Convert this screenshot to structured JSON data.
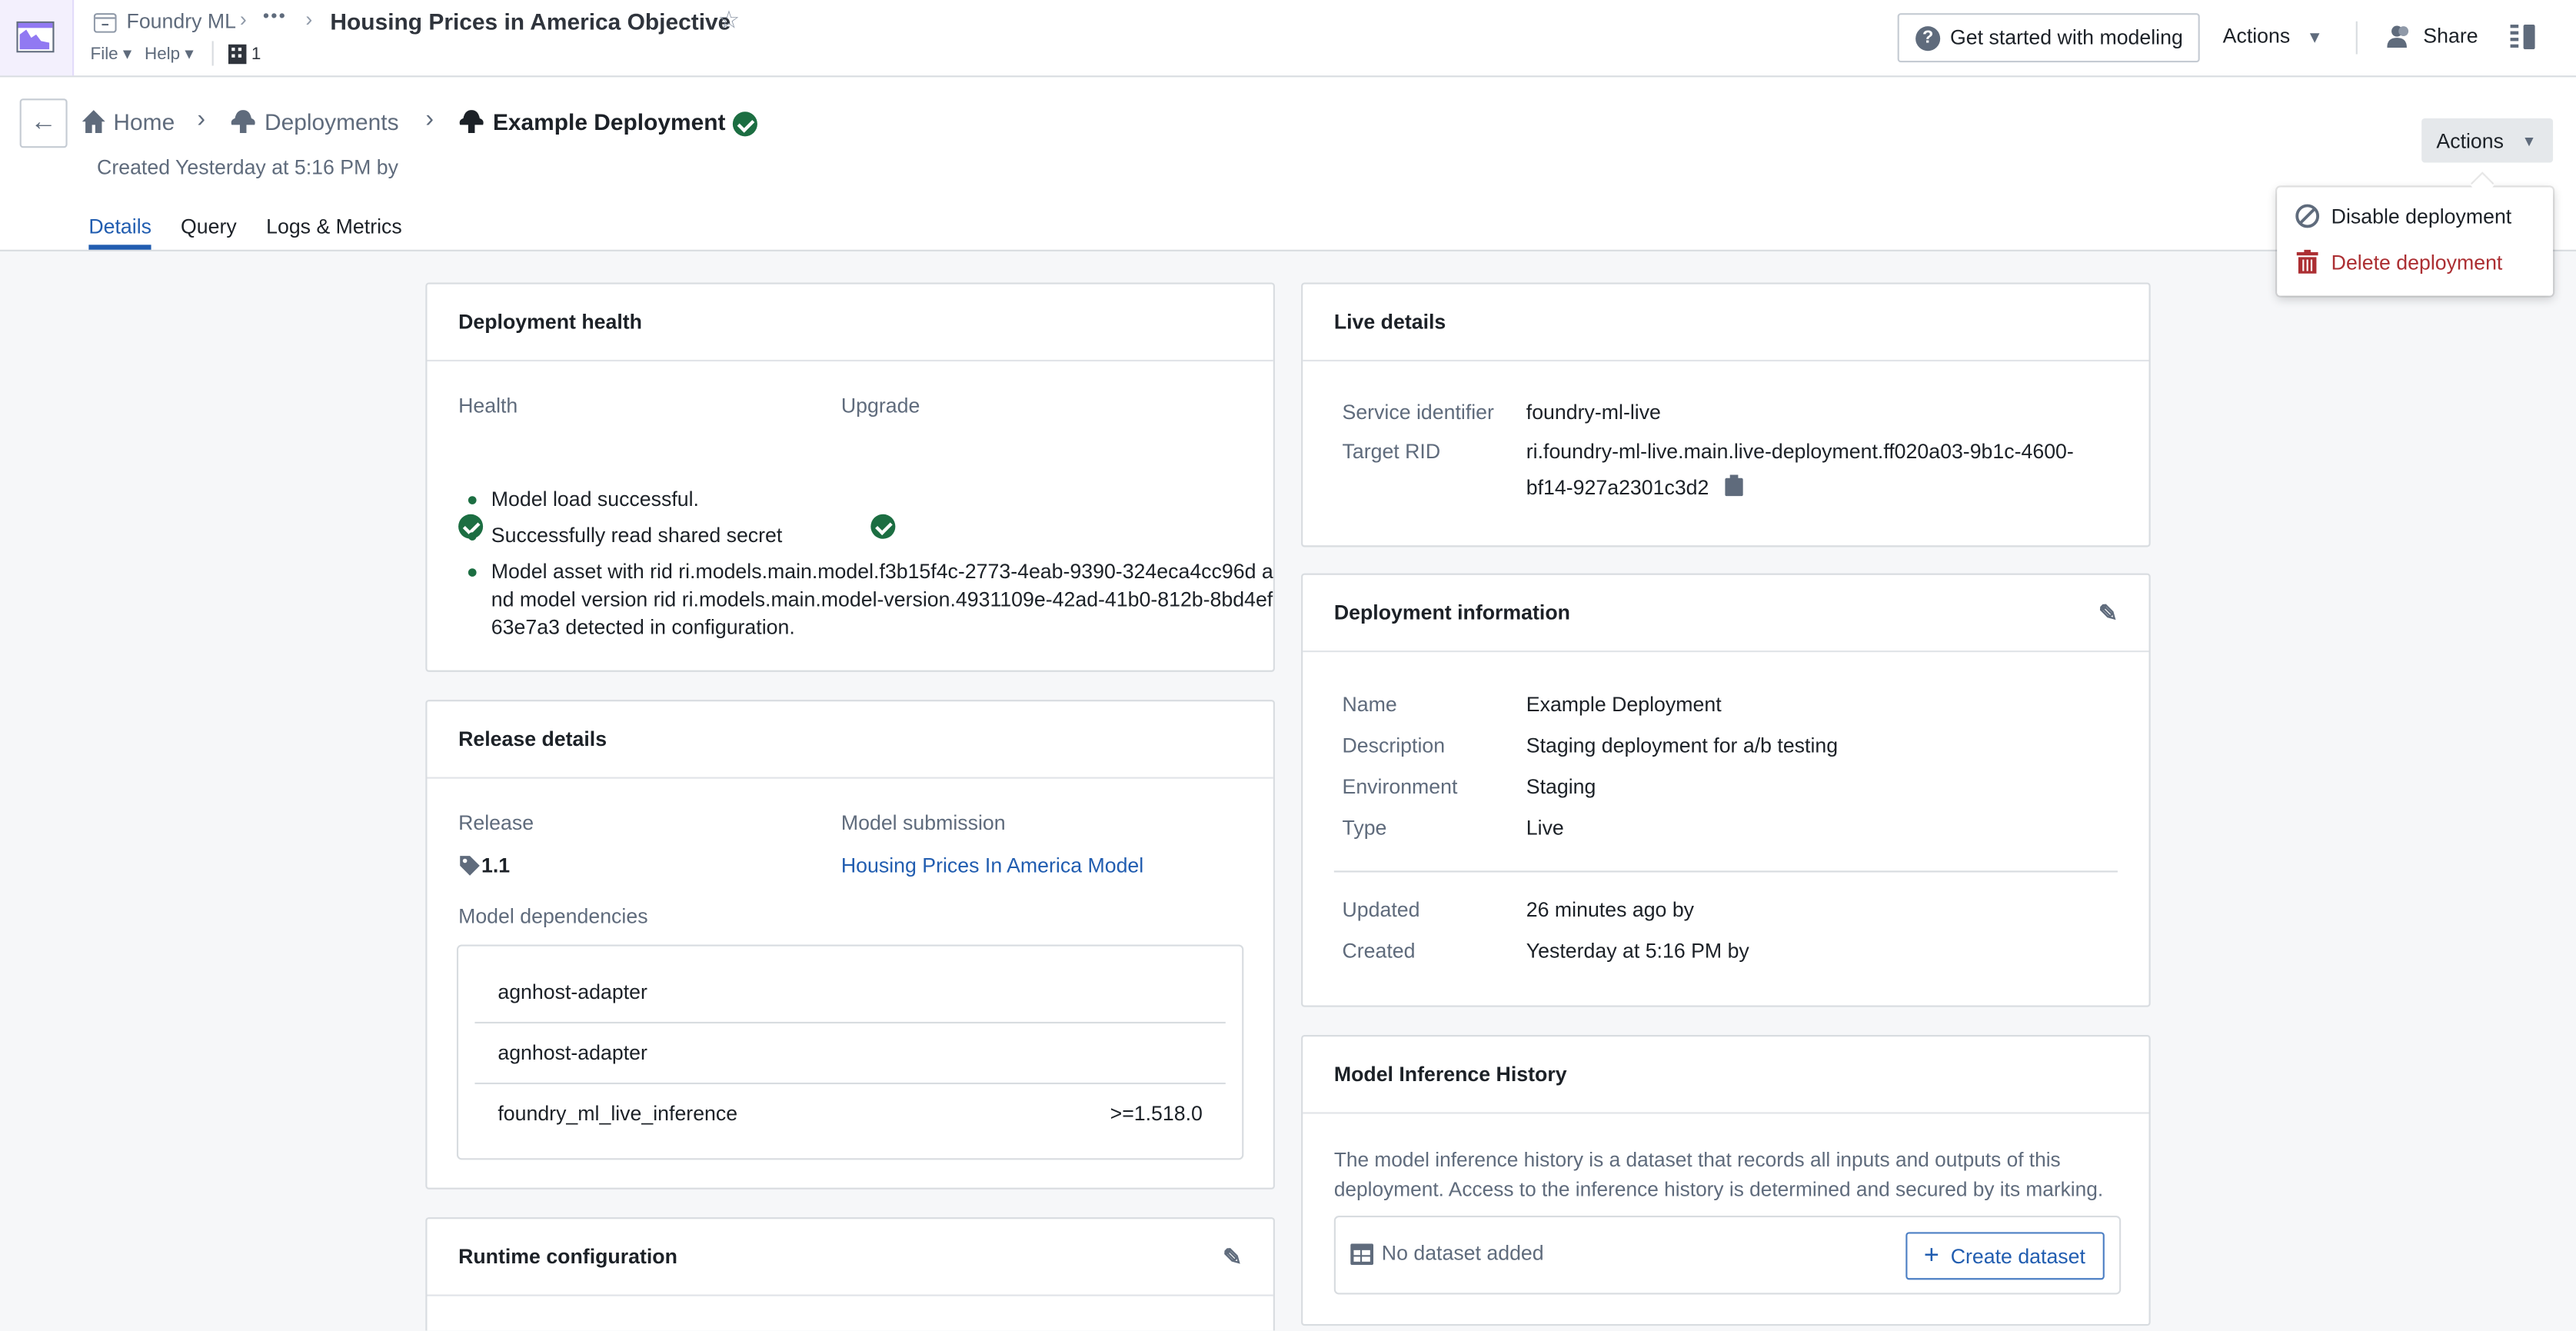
{
  "topbar": {
    "breadcrumb_root": "Foundry ML",
    "ellipsis": "•••",
    "title": "Housing Prices in America Objective",
    "file_menu": "File",
    "help_menu": "Help",
    "org_count": "1",
    "get_started": "Get started with modeling",
    "actions": "Actions",
    "share": "Share"
  },
  "header": {
    "breadcrumb": [
      "Home",
      "Deployments",
      "Example Deployment"
    ],
    "created": "Created Yesterday at 5:16 PM by",
    "actions": "Actions",
    "tabs": [
      {
        "label": "Details",
        "active": true
      },
      {
        "label": "Query"
      },
      {
        "label": "Logs & Metrics"
      }
    ]
  },
  "actions_menu": {
    "items": [
      {
        "label": "Disable deployment",
        "icon": "disable-icon"
      },
      {
        "label": "Delete deployment",
        "icon": "trash-icon",
        "color": "#ac2f33"
      }
    ]
  },
  "deployment_health": {
    "title": "Deployment health",
    "health_label": "Health",
    "upgrade_label": "Upgrade",
    "messages": [
      "Model load successful.",
      "Successfully read shared secret",
      "Model asset with rid ri.models.main.model.f3b15f4c-2773-4eab-9390-324eca4cc96d and model version rid ri.models.main.model-version.4931109e-42ad-41b0-812b-8bd4ef63e7a3 detected in configuration."
    ]
  },
  "release_details": {
    "title": "Release details",
    "release_label": "Release",
    "release_value": "1.1",
    "submission_label": "Model submission",
    "submission_value": "Housing Prices In America Model",
    "dependencies_label": "Model dependencies",
    "dependencies": [
      {
        "name": "agnhost-adapter",
        "version": ""
      },
      {
        "name": "agnhost-adapter",
        "version": ""
      },
      {
        "name": "foundry_ml_live_inference",
        "version": ">=1.518.0"
      }
    ]
  },
  "runtime_configuration": {
    "title": "Runtime configuration"
  },
  "live_details": {
    "title": "Live details",
    "service_identifier_label": "Service identifier",
    "service_identifier": "foundry-ml-live",
    "target_rid_label": "Target RID",
    "target_rid": "ri.foundry-ml-live.main.live-deployment.ff020a03-9b1c-4600-bf14-927a2301c3d2"
  },
  "deployment_information": {
    "title": "Deployment information",
    "fields": [
      {
        "label": "Name",
        "value": "Example Deployment"
      },
      {
        "label": "Description",
        "value": "Staging deployment for a/b testing"
      },
      {
        "label": "Environment",
        "value": "Staging"
      },
      {
        "label": "Type",
        "value": "Live"
      }
    ],
    "meta": [
      {
        "label": "Updated",
        "value": "26 minutes ago by"
      },
      {
        "label": "Created",
        "value": "Yesterday at 5:16 PM by"
      }
    ]
  },
  "inference_history": {
    "title": "Model Inference History",
    "description": "The model inference history is a dataset that records all inputs and outputs of this deployment. Access to the inference history is determined and secured by its marking.",
    "empty": "No dataset added",
    "create": "Create dataset"
  },
  "colors": {
    "accent": "#215db0",
    "success": "#1c6e42",
    "danger": "#ac2f33",
    "app_tile": "#9179f2"
  }
}
